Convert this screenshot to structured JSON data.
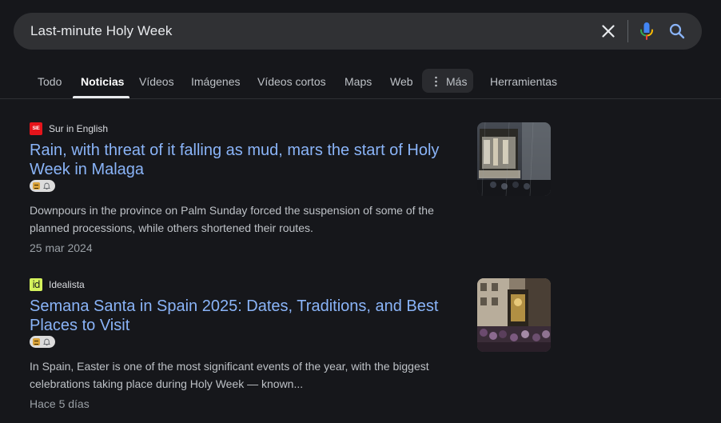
{
  "search": {
    "query": "Last-minute Holy Week",
    "clear_icon": "close-icon",
    "mic_icon": "microphone-icon",
    "search_icon": "search-icon"
  },
  "tabs": [
    {
      "label": "Todo",
      "active": false
    },
    {
      "label": "Noticias",
      "active": true
    },
    {
      "label": "Vídeos",
      "active": false
    },
    {
      "label": "Imágenes",
      "active": false
    },
    {
      "label": "Vídeos cortos",
      "active": false
    },
    {
      "label": "Maps",
      "active": false
    },
    {
      "label": "Web",
      "active": false
    }
  ],
  "more": {
    "label": "Más",
    "icon": "more-vert-icon"
  },
  "tools": {
    "label": "Herramientas"
  },
  "results": [
    {
      "source": "Sur in English",
      "favicon_text": "SIE",
      "title": "Rain, with threat of it falling as mud, mars the start of Holy Week in Malaga",
      "snippet": "Downpours in the province on Palm Sunday forced the suspension of some of the planned processions, while others shortened their routes.",
      "date": "25 mar 2024"
    },
    {
      "source": "Idealista",
      "favicon_text": "id",
      "title": "Semana Santa in Spain 2025: Dates, Traditions, and Best Places to Visit",
      "snippet": "In Spain, Easter is one of the most significant events of the year, with the biggest celebrations taking place during Holy Week — known...",
      "date": "Hace 5 días"
    }
  ],
  "colors": {
    "background": "#16171b",
    "search_bar": "#303134",
    "link": "#8ab4f8",
    "text_secondary": "#bdc1c6",
    "date": "#9aa0a6"
  }
}
